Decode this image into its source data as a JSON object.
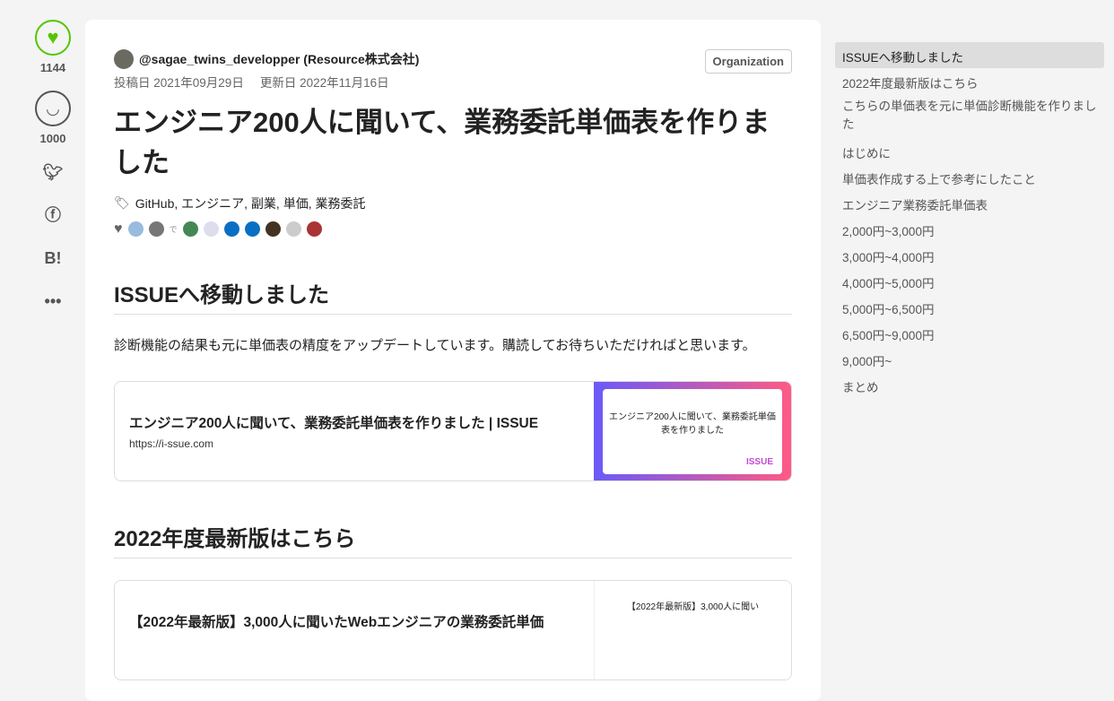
{
  "sidebar": {
    "likes": "1144",
    "stocks": "1000"
  },
  "article": {
    "author": "@sagae_twins_developper (Resource株式会社)",
    "org_badge": "Organization",
    "posted": "投稿日 2021年09月29日",
    "updated": "更新日 2022年11月16日",
    "title": "エンジニア200人に聞いて、業務委託単価表を作りました",
    "tags": "GitHub, エンジニア, 副業, 単価, 業務委託",
    "likers_sep": "で",
    "section1": "ISSUEへ移動しました",
    "para1": "診断機能の結果も元に単価表の精度をアップデートしています。購読してお待ちいただければと思います。",
    "card1": {
      "title": "エンジニア200人に聞いて、業務委託単価表を作りました | ISSUE",
      "url": "https://i-ssue.com",
      "thumb_title": "エンジニア200人に聞いて、業務委託単価表を作りました",
      "thumb_brand": "ISSUE"
    },
    "section2": "2022年度最新版はこちら",
    "card2": {
      "title": "【2022年最新版】3,000人に聞いたWebエンジニアの業務委託単価",
      "thumb_title": "【2022年最新版】3,000人に聞い"
    }
  },
  "toc": [
    "ISSUEへ移動しました",
    "2022年度最新版はこちら",
    "こちらの単価表を元に単価診断機能を作りました",
    "はじめに",
    "単価表作成する上で参考にしたこと",
    "エンジニア業務委託単価表",
    "2,000円~3,000円",
    "3,000円~4,000円",
    "4,000円~5,000円",
    "5,000円~6,500円",
    "6,500円~9,000円",
    "9,000円~",
    "まとめ"
  ]
}
